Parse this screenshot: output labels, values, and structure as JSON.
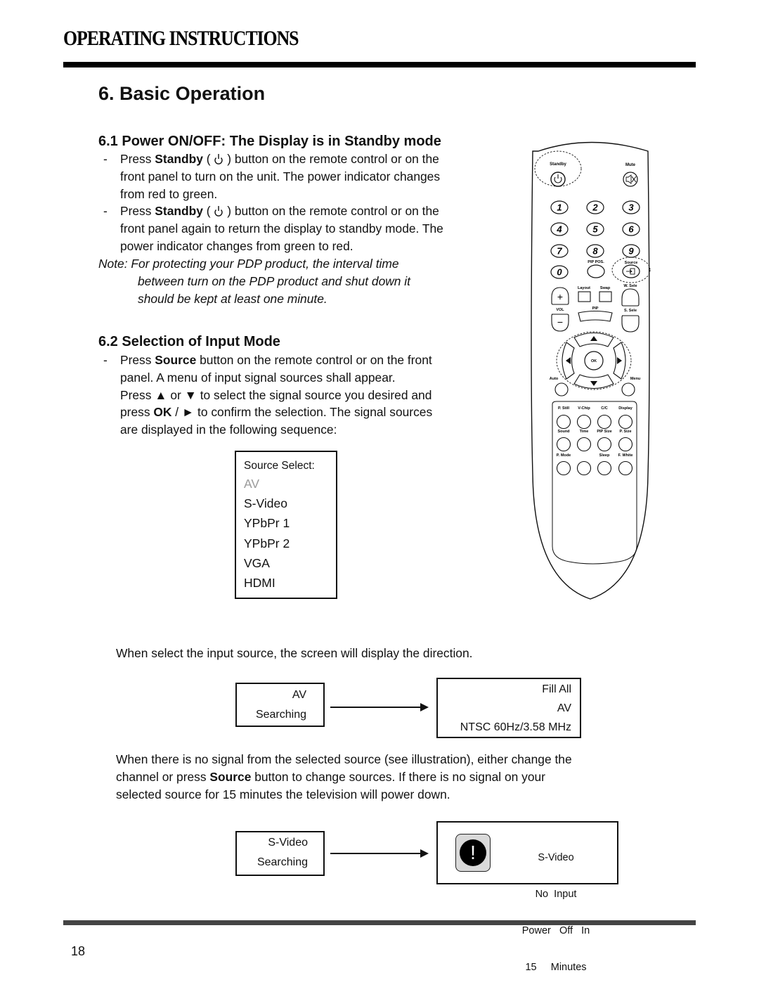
{
  "header": {
    "title": "OPERATING INSTRUCTIONS"
  },
  "section": {
    "title": "6. Basic Operation",
    "sub1": {
      "title": "6.1 Power ON/OFF: The Display is in Standby mode",
      "bullets": [
        {
          "dash": "-",
          "pre": "Press ",
          "bold": "Standby",
          "open": " ( ",
          "icon": "power-icon",
          "close": " ) button on the remote control or on the",
          "lines": [
            "front panel to turn on the unit. The power indicator changes",
            "from red to green."
          ]
        },
        {
          "dash": "-",
          "pre": "Press ",
          "bold": "Standby",
          "open": " ( ",
          "icon": "power-icon",
          "close": " ) button on the remote control or on the",
          "lines": [
            "front panel again to return the display to standby mode. The",
            "power indicator changes from green to red."
          ]
        }
      ],
      "note": {
        "label": "Note:",
        "lines": [
          "For protecting your PDP product, the interval time",
          "between turn on the PDP product and shut down it",
          "should be kept at least one minute."
        ]
      }
    },
    "sub2": {
      "title": "6.2 Selection of Input Mode",
      "bullet": {
        "dash": "-",
        "pre": "Press ",
        "bold": "Source",
        "post": " button on the remote control or on the front",
        "line2": "panel. A menu of input signal sources shall appear.",
        "line3_pre": "Press ",
        "up": "▲",
        "line3_mid": " or ",
        "down": "▼",
        "line3_post": " to select the signal source you desired and",
        "line4_pre": "press ",
        "ok": "OK",
        "line4_mid": " / ",
        "right": "►",
        "line4_post": " to confirm the selection. The signal sources",
        "line5": "are displayed in the following sequence:"
      },
      "source_select": {
        "title": "Source Select:",
        "items": [
          {
            "label": "AV",
            "highlighted": true
          },
          {
            "label": "S-Video"
          },
          {
            "label": "YPbPr 1"
          },
          {
            "label": "YPbPr 2"
          },
          {
            "label": "VGA"
          },
          {
            "label": "HDMI"
          }
        ]
      },
      "direction_text": "When select the input source, the screen will display the direction.",
      "diagram1": {
        "left": {
          "line1": "AV",
          "line2": "Searching"
        },
        "right": {
          "line1": "Fill All",
          "line2": "AV",
          "line3": "NTSC 60Hz/3.58 MHz"
        }
      },
      "nosignal": {
        "pre": "When there is no signal from the selected source (see illustration), either change the",
        "line2_pre": "channel or press ",
        "line2_bold": "Source",
        "line2_post": " button to change sources. If there is no signal on your",
        "line3": "selected source for 15 minutes the television will power down."
      },
      "diagram2": {
        "left": {
          "line1": "S-Video",
          "line2": "Searching"
        },
        "right": {
          "icon": "warning-icon",
          "glyph": "!",
          "line1": "S-Video",
          "line2": "No  Input",
          "line3": "Power   Off   In",
          "line4": "15     Minutes"
        }
      }
    }
  },
  "remote": {
    "labels": {
      "standby": "Standby",
      "mute": "Mute",
      "digits": [
        "1",
        "2",
        "3",
        "4",
        "5",
        "6",
        "7",
        "8",
        "9",
        "0"
      ],
      "pip_pos": "PIP POS.",
      "source": "Source",
      "layout": "Layout",
      "swap": "Swap",
      "w_sele": "W. Sele",
      "vol": "VOL",
      "vol_plus": "+",
      "vol_minus": "−",
      "pip": "PIP",
      "s_sele": "S. Sele",
      "ok": "OK",
      "auto": "Auto",
      "menu": "Menu",
      "row1": [
        "P. Still",
        "V-Chip",
        "C/C",
        "Display"
      ],
      "row2": [
        "Sound",
        "Time",
        "PIP Size",
        "P. Size"
      ],
      "row3": [
        "P. Mode",
        "",
        "Sleep",
        "F. White"
      ]
    }
  },
  "footer": {
    "page_number": "18"
  }
}
